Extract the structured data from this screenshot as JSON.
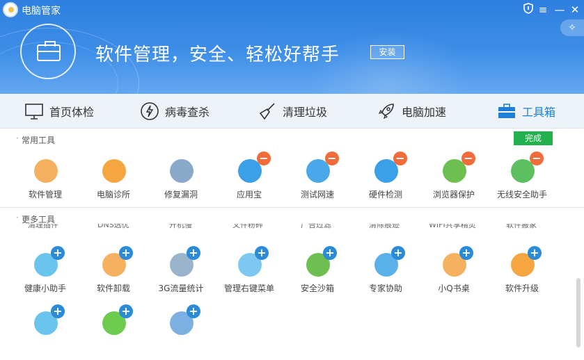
{
  "app": {
    "title": "电脑管家"
  },
  "hero": {
    "headline": "软件管理，安全、轻松好帮手",
    "install_label": "安装"
  },
  "nav": [
    {
      "label": "首页体检",
      "icon": "monitor-icon"
    },
    {
      "label": "病毒查杀",
      "icon": "lightning-icon"
    },
    {
      "label": "清理垃圾",
      "icon": "broom-icon"
    },
    {
      "label": "电脑加速",
      "icon": "rocket-icon"
    },
    {
      "label": "工具箱",
      "icon": "toolbox-icon",
      "active": true
    }
  ],
  "common": {
    "title": "常用工具",
    "done_label": "完成",
    "items": [
      {
        "label": "软件管理",
        "icon": "clover-icon",
        "color": "#f5b060"
      },
      {
        "label": "电脑诊所",
        "icon": "stethoscope-icon",
        "color": "#f5a640"
      },
      {
        "label": "修复漏洞",
        "icon": "repair-icon",
        "color": "#8aa8c8"
      },
      {
        "label": "应用宝",
        "icon": "app-store-icon",
        "color": "#3aa0e8"
      },
      {
        "label": "测试网速",
        "icon": "speed-icon",
        "color": "#4aa8ea"
      },
      {
        "label": "硬件检测",
        "icon": "chip-icon",
        "color": "#3aa0e8"
      },
      {
        "label": "浏览器保护",
        "icon": "browser-shield-icon",
        "color": "#6dbf50"
      },
      {
        "label": "无线安全助手",
        "icon": "wifi-shield-icon",
        "color": "#5cc060"
      }
    ]
  },
  "more": {
    "title": "更多工具",
    "clipped": [
      "清理插件",
      "DNS选优",
      "开机慢",
      "文件粉碎",
      "广告过滤",
      "清除痕迹",
      "WIFI共享精灵",
      "软件搬家"
    ],
    "items": [
      {
        "label": "健康小助手",
        "icon": "alarm-icon",
        "color": "#6ac4ee"
      },
      {
        "label": "软件卸载",
        "icon": "trash-icon",
        "color": "#f5b060"
      },
      {
        "label": "3G流量统计",
        "icon": "3g-icon",
        "color": "#9ab4cc"
      },
      {
        "label": "管理右键菜单",
        "icon": "mouse-icon",
        "color": "#7cc8f0"
      },
      {
        "label": "安全沙箱",
        "icon": "sandbox-icon",
        "color": "#6dbf50"
      },
      {
        "label": "专家协助",
        "icon": "expert-icon",
        "color": "#5ab0e8"
      },
      {
        "label": "小Q书桌",
        "icon": "desk-icon",
        "color": "#f5b060"
      },
      {
        "label": "软件升级",
        "icon": "upgrade-icon",
        "color": "#f5a640"
      },
      {
        "label": "",
        "icon": "cloud-icon",
        "color": "#6ac4ee"
      },
      {
        "label": "",
        "icon": "wechat-icon",
        "color": "#6dcc50"
      },
      {
        "label": "",
        "icon": "router-icon",
        "color": "#7cb0e0"
      }
    ]
  }
}
